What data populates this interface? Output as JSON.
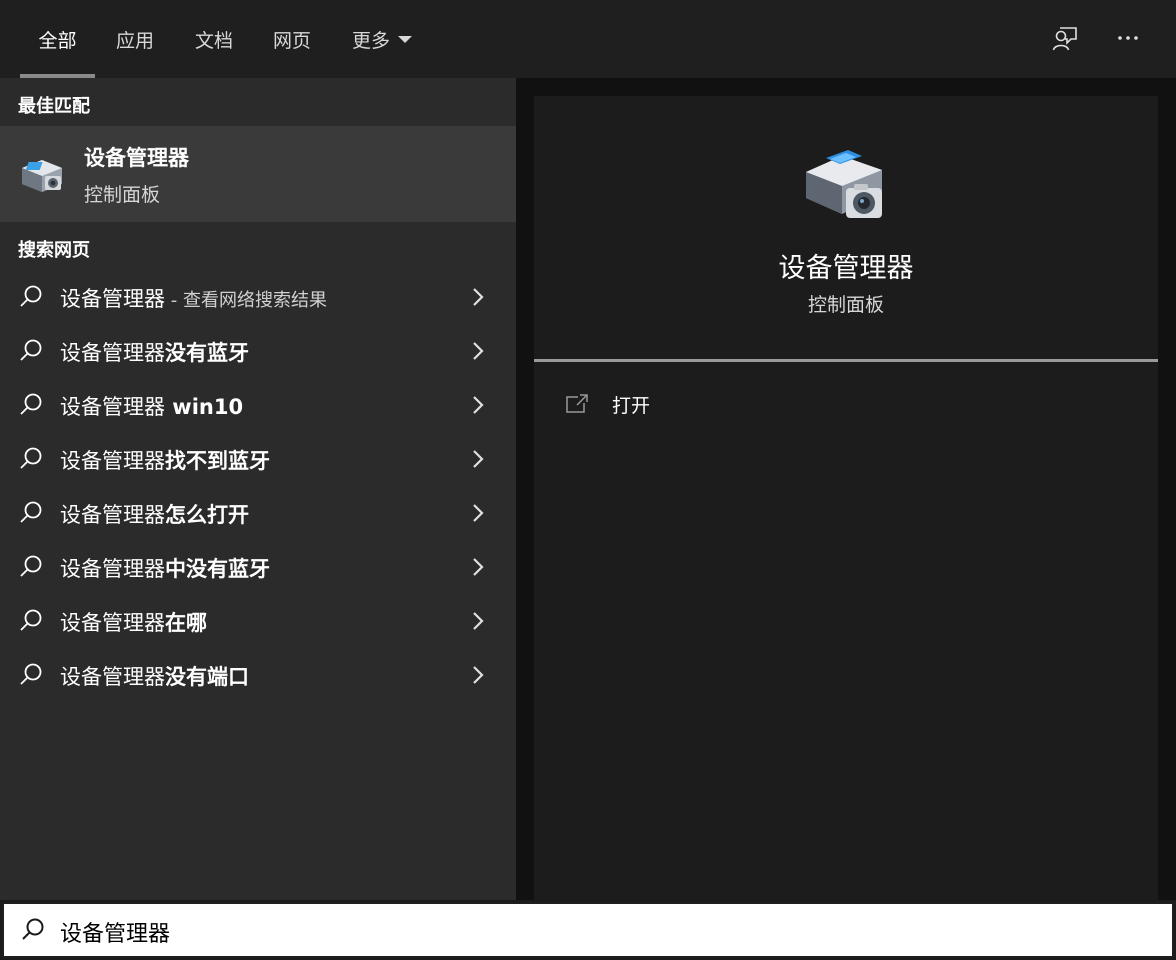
{
  "tabs": [
    {
      "label": "全部",
      "active": true
    },
    {
      "label": "应用",
      "active": false
    },
    {
      "label": "文档",
      "active": false
    },
    {
      "label": "网页",
      "active": false
    },
    {
      "label": "更多",
      "active": false
    }
  ],
  "top_icons": {
    "feedback": "feedback-icon",
    "more": "more-options-icon"
  },
  "best_match": {
    "heading": "最佳匹配",
    "title": "设备管理器",
    "subtitle": "控制面板",
    "icon": "device-manager-icon"
  },
  "web_search": {
    "heading": "搜索网页",
    "results": [
      {
        "prefix": "设备管理器",
        "bold": "",
        "suffix": " - 查看网络搜索结果"
      },
      {
        "prefix": "设备管理器",
        "bold": "没有蓝牙",
        "suffix": ""
      },
      {
        "prefix": "设备管理器",
        "bold": " win10",
        "suffix": ""
      },
      {
        "prefix": "设备管理器",
        "bold": "找不到蓝牙",
        "suffix": ""
      },
      {
        "prefix": "设备管理器",
        "bold": "怎么打开",
        "suffix": ""
      },
      {
        "prefix": "设备管理器",
        "bold": "中没有蓝牙",
        "suffix": ""
      },
      {
        "prefix": "设备管理器",
        "bold": "在哪",
        "suffix": ""
      },
      {
        "prefix": "设备管理器",
        "bold": "没有端口",
        "suffix": ""
      }
    ]
  },
  "preview": {
    "title": "设备管理器",
    "subtitle": "控制面板",
    "actions": [
      {
        "label": "打开",
        "icon": "open-icon"
      }
    ]
  },
  "search": {
    "value": "设备管理器"
  },
  "colors": {
    "accent": "#8a8a8a",
    "left_bg": "#2b2b2b",
    "selected_bg": "#3a3a3a",
    "right_bg": "#1c1c1c"
  }
}
